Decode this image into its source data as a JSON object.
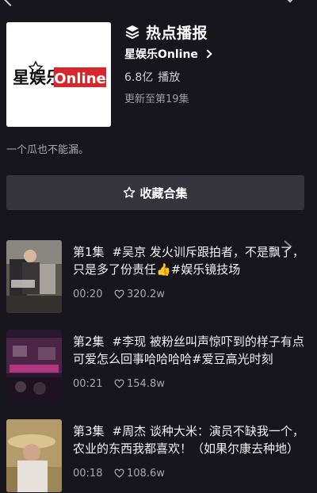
{
  "collection": {
    "title": "热点播报",
    "author": "星娱乐Online",
    "plays": "6.8亿",
    "plays_label": "播放",
    "update": "更新至第19集",
    "description": "一个瓜也不能漏。",
    "collect_label": "收藏合集",
    "cover_text_cn": "星娱乐",
    "cover_text_en": "Online"
  },
  "episodes": [
    {
      "number": "第1集",
      "title": "#吴京 发火训斥跟拍者，不是飘了，只是多了份责任👍#娱乐镜技场",
      "duration": "00:20",
      "likes": "320.2w"
    },
    {
      "number": "第2集",
      "title": "#李现 被粉丝叫声惊吓到的样子有点可爱怎么回事哈哈哈哈#爱豆高光时刻",
      "duration": "00:21",
      "likes": "154.8w"
    },
    {
      "number": "第3集",
      "title": "#周杰 谈种大米：演员不缺我一个，农业的东西我都喜欢！（如果尔康去种地）",
      "duration": "00:18",
      "likes": "108.6w"
    }
  ],
  "colors": {
    "background": "#17161d",
    "button": "#35343c",
    "brand_red": "#d9262c"
  }
}
